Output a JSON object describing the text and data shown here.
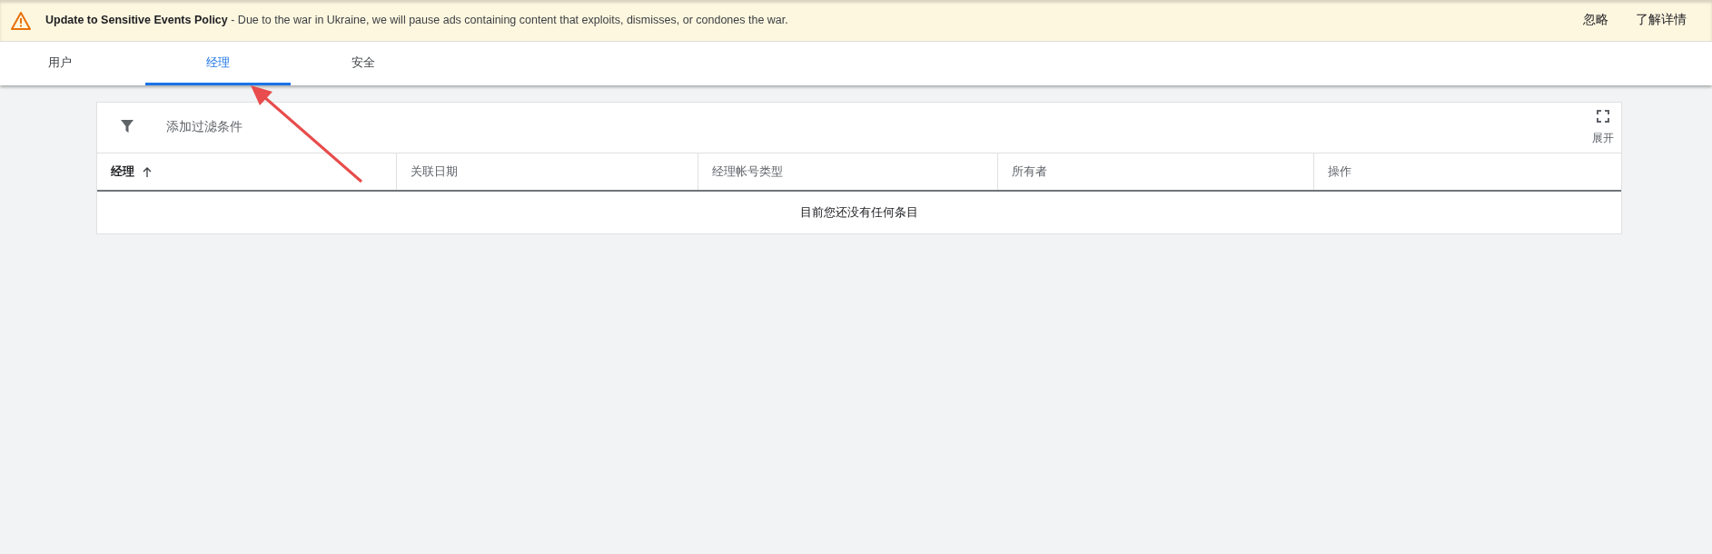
{
  "banner": {
    "title": "Update to Sensitive Events Policy",
    "message": " - Due to the war in Ukraine, we will pause ads containing content that exploits, dismisses, or condones the war.",
    "actions": [
      "忽略",
      "了解详情"
    ]
  },
  "tabs": [
    {
      "label": "用户",
      "selected": false
    },
    {
      "label": "经理",
      "selected": true
    },
    {
      "label": "安全",
      "selected": false
    }
  ],
  "toolbar": {
    "filter_label": "添加过滤条件",
    "expand_label": "展开"
  },
  "table": {
    "columns": [
      {
        "label": "经理",
        "sorted": true
      },
      {
        "label": "关联日期",
        "sorted": false
      },
      {
        "label": "经理帐号类型",
        "sorted": false
      },
      {
        "label": "所有者",
        "sorted": false
      },
      {
        "label": "操作",
        "sorted": false
      }
    ],
    "empty_message": "目前您还没有任何条目"
  }
}
